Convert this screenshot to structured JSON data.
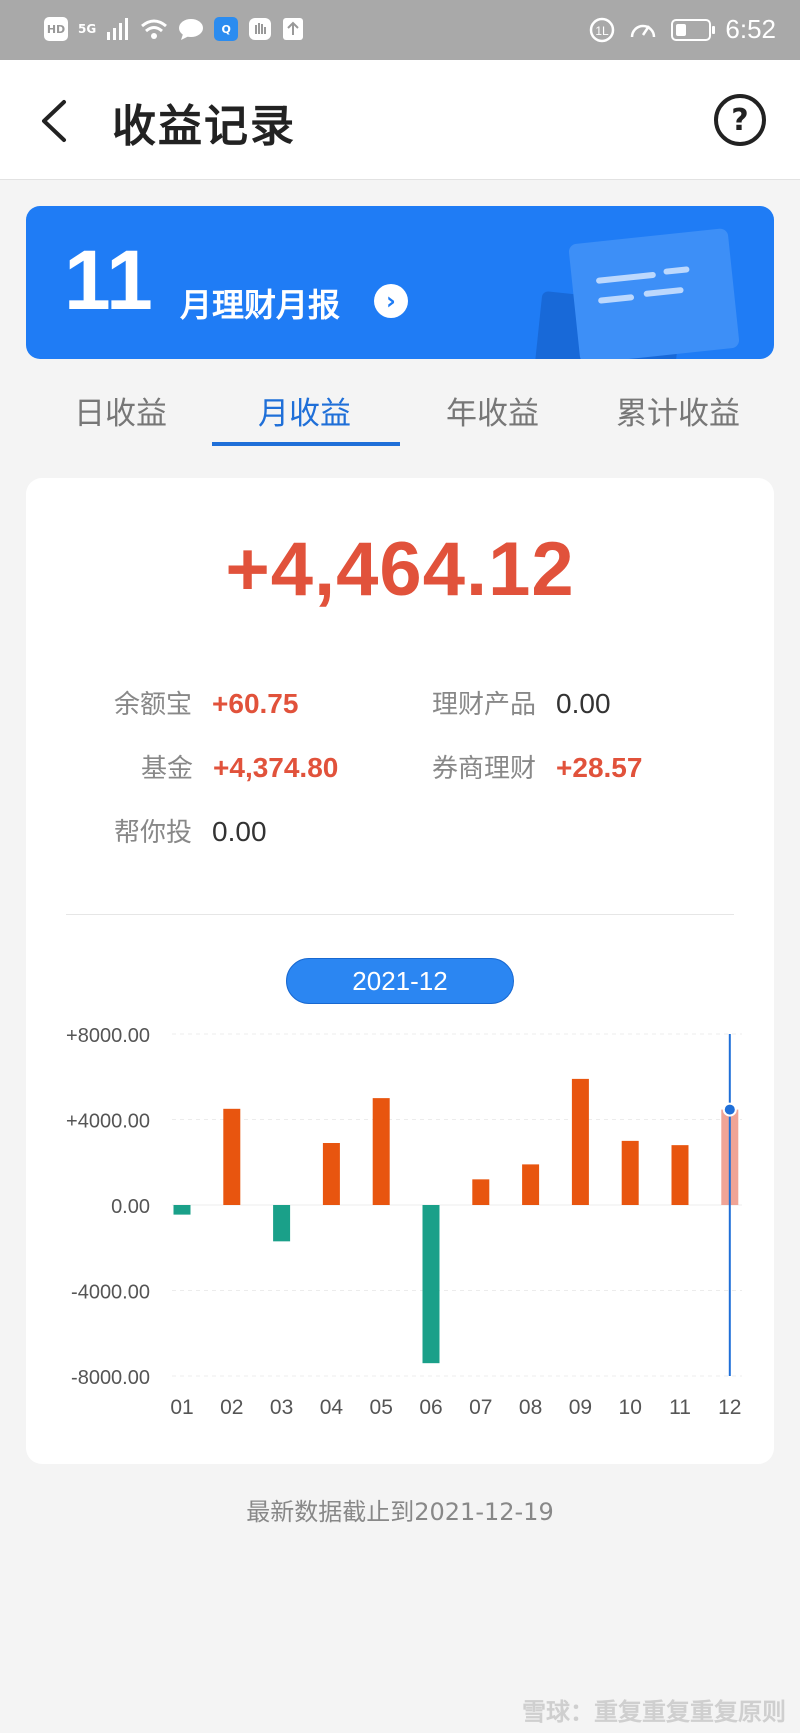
{
  "status_bar": {
    "left_icons": [
      "HD",
      "5G",
      "signal-icon",
      "wifi-icon",
      "message-icon",
      "search-app-icon",
      "hand-icon",
      "upload-icon"
    ],
    "time": "6:52"
  },
  "header": {
    "title": "收益记录",
    "help": "?"
  },
  "banner": {
    "number": "11",
    "label": "月理财月报",
    "arrow": "›"
  },
  "tabs": [
    {
      "label": "日收益",
      "active": false
    },
    {
      "label": "月收益",
      "active": true
    },
    {
      "label": "年收益",
      "active": false
    },
    {
      "label": "累计收益",
      "active": false
    }
  ],
  "summary": {
    "total": "+4,464.12",
    "items": [
      {
        "key": "余额宝",
        "value": "+60.75",
        "positive": true
      },
      {
        "key": "理财产品",
        "value": "0.00",
        "positive": false
      },
      {
        "key": "基金",
        "value": "+4,374.80",
        "positive": true
      },
      {
        "key": "券商理财",
        "value": "+28.57",
        "positive": true
      },
      {
        "key": "帮你投",
        "value": "0.00",
        "positive": false
      }
    ]
  },
  "month_selector": "2021-12",
  "chart_data": {
    "type": "bar",
    "categories": [
      "01",
      "02",
      "03",
      "04",
      "05",
      "06",
      "07",
      "08",
      "09",
      "10",
      "11",
      "12"
    ],
    "values": [
      -450,
      4500,
      -1700,
      2900,
      5000,
      -7400,
      1200,
      1900,
      5900,
      3000,
      2800,
      4464.12
    ],
    "y_tick_labels": [
      "+8000.00",
      "+4000.00",
      "0.00",
      "-4000.00",
      "-8000.00"
    ],
    "ylim": [
      -8000,
      8000
    ],
    "positive_color": "#e8550f",
    "negative_color": "#1aa089",
    "selected_color": "#f0a496",
    "selected_index": 11,
    "cursor_color": "#1f6fd8"
  },
  "footnote": "最新数据截止到2021-12-19",
  "watermark": "雪球：重复重复重复原则"
}
